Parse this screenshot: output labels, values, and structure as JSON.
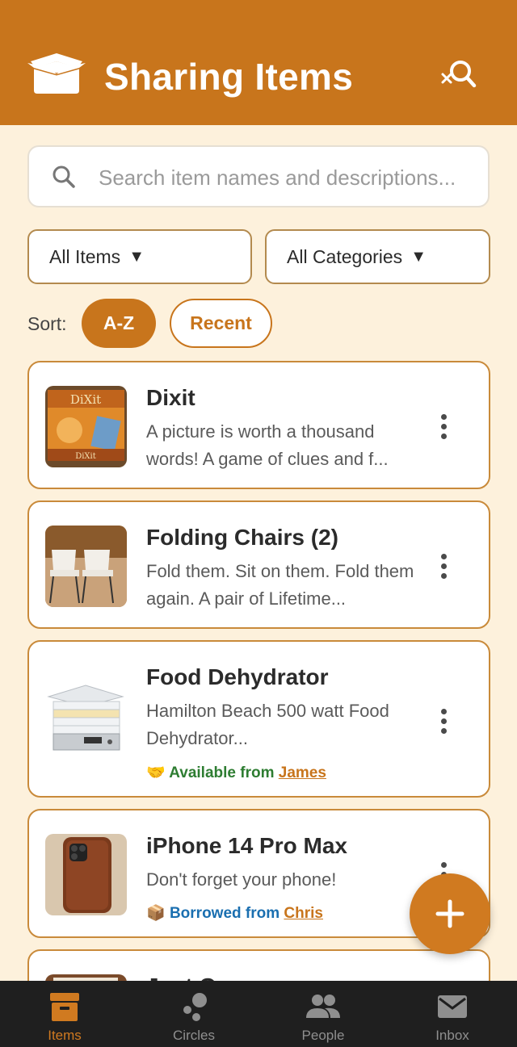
{
  "header": {
    "title": "Sharing Items"
  },
  "search": {
    "placeholder": "Search item names and descriptions..."
  },
  "filters": {
    "type_label": "All Items",
    "category_label": "All Categories",
    "arrow": "▼"
  },
  "sort": {
    "label": "Sort:",
    "options": [
      "A-Z",
      "Recent"
    ],
    "selected": "A-Z"
  },
  "items": [
    {
      "title": "Dixit",
      "description": "A picture is worth a thousand words! A game of clues and f..."
    },
    {
      "title": "Folding Chairs (2)",
      "description": "Fold them. Sit on them. Fold them again. A pair of Lifetime..."
    },
    {
      "title": "Food Dehydrator",
      "description": "Hamilton Beach 500 watt Food Dehydrator...",
      "status_text": "Available from",
      "status_name": "James",
      "status_icon": "handshake-icon"
    },
    {
      "title": "iPhone 14 Pro Max",
      "description": "Don't forget your phone!",
      "status_text": "Borrowed from",
      "status_name": "Chris",
      "status_icon": "package-icon"
    },
    {
      "title": "Just One"
    }
  ],
  "nav": [
    {
      "label": "Items",
      "icon": "box-icon",
      "active": true
    },
    {
      "label": "Circles",
      "icon": "circles-icon"
    },
    {
      "label": "People",
      "icon": "people-icon"
    },
    {
      "label": "Inbox",
      "icon": "mail-icon"
    }
  ],
  "colors": {
    "brand": "#c8751c",
    "background": "#fdf1dc",
    "available": "#2e7d32",
    "borrowed": "#1a6fb0"
  }
}
